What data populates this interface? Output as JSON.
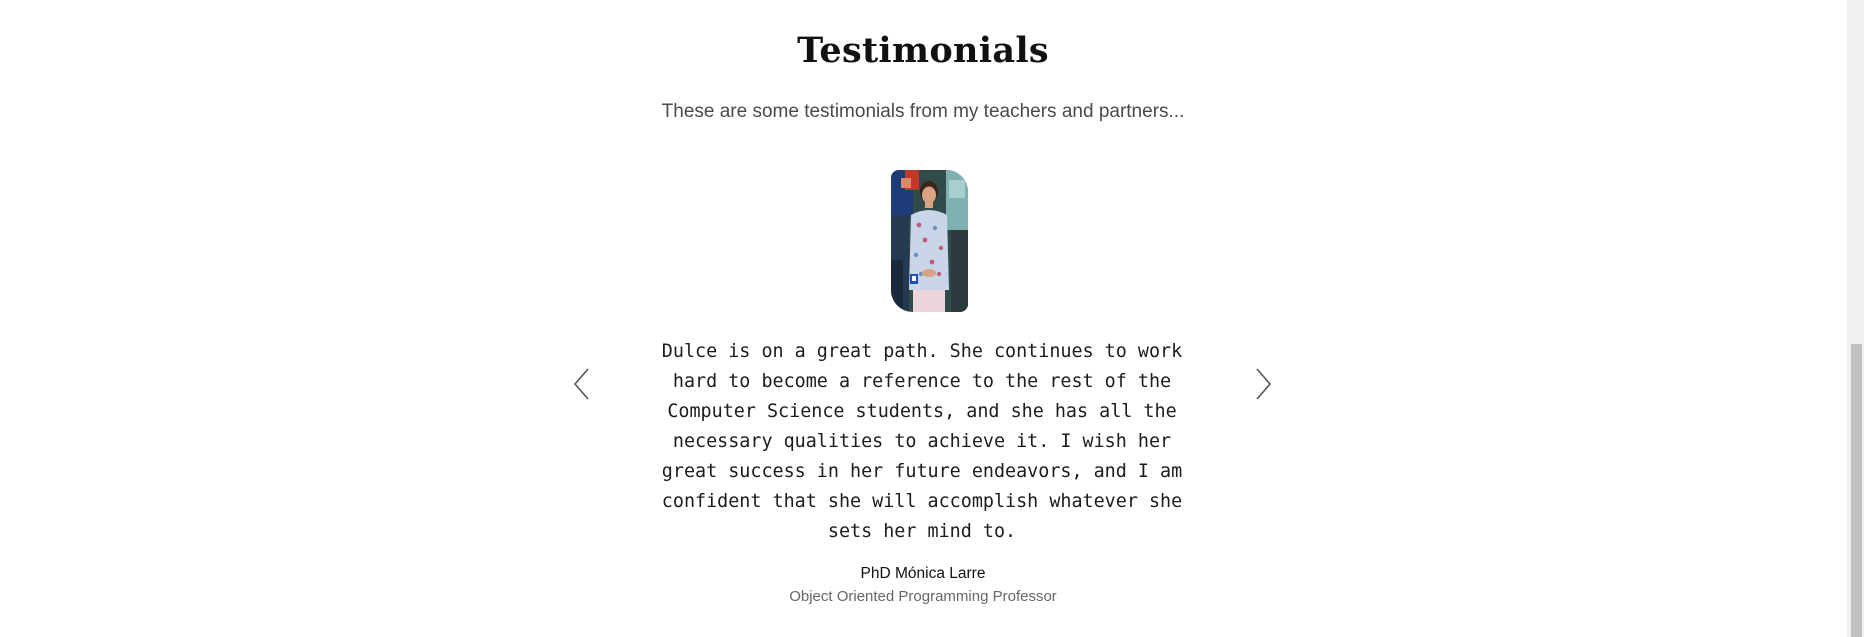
{
  "testimonials": {
    "title": "Testimonials",
    "subtitle": "These are some testimonials from my teachers and partners...",
    "current": {
      "quote": "Dulce is on a great path. She continues to work hard to become a reference to the rest of the Computer Science students, and she has all the necessary qualities to achieve it. I wish her great success in her future endeavors, and I am confident that she will accomplish whatever she sets her mind to.",
      "author": "PhD Mónica Larre",
      "role": "Object Oriented Programming Professor"
    },
    "icons": {
      "prev": "chevron-left-icon",
      "next": "chevron-right-icon"
    }
  }
}
